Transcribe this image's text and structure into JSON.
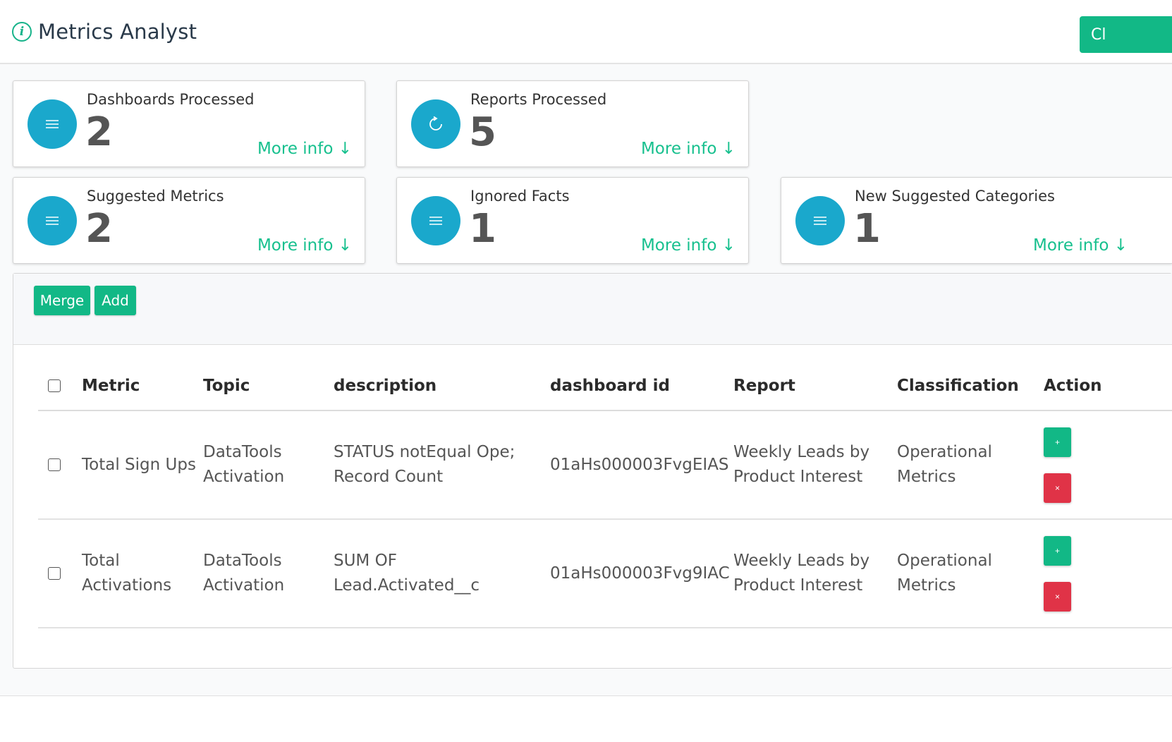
{
  "header": {
    "title": "Metrics Analyst",
    "info_icon": "i",
    "right_button": "Cl"
  },
  "stats": [
    {
      "label": "Dashboards Processed",
      "value": "2",
      "link": "More info ↓",
      "icon": "menu-icon"
    },
    {
      "label": "Reports Processed",
      "value": "5",
      "link": "More info ↓",
      "icon": "refresh-icon"
    },
    {
      "label": "Suggested Metrics",
      "value": "2",
      "link": "More info ↓",
      "icon": "menu-icon"
    },
    {
      "label": "Ignored Facts",
      "value": "1",
      "link": "More info ↓",
      "icon": "menu-icon"
    },
    {
      "label": "New Suggested Categories",
      "value": "1",
      "link": "More info ↓",
      "icon": "menu-icon"
    }
  ],
  "toolbar": {
    "merge_label": "Merge",
    "add_label": "Add"
  },
  "table": {
    "columns": [
      "Metric",
      "Topic",
      "description",
      "dashboard id",
      "Report",
      "Classification",
      "Action"
    ],
    "rows": [
      {
        "metric": "Total Sign Ups",
        "topic": "DataTools Activation",
        "description": "STATUS notEqual Ope; Record Count",
        "dashboard_id": "01aHs000003FvgEIAS",
        "report": "Weekly Leads by Product Interest",
        "classification": "Operational Metrics"
      },
      {
        "metric": "Total Activations",
        "topic": "DataTools Activation",
        "description": "SUM OF Lead.Activated__c",
        "dashboard_id": "01aHs000003Fvg9IAC",
        "report": "Weekly Leads by Product Interest",
        "classification": "Operational Metrics"
      }
    ],
    "add_symbol": "+",
    "delete_symbol": "×"
  },
  "colors": {
    "accent_green": "#12b886",
    "link_green": "#17c08e",
    "icon_blue": "#1aa8cc",
    "danger_red": "#e03347"
  }
}
